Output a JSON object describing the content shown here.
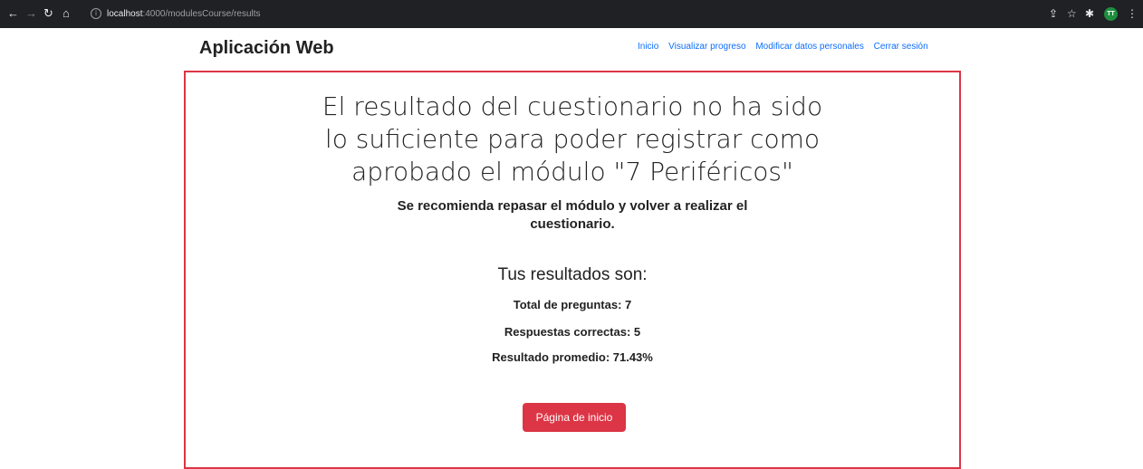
{
  "browser": {
    "url_host": "localhost",
    "url_rest": ":4000/modulesCourse/results",
    "avatar_initials": "TT"
  },
  "navbar": {
    "brand": "Aplicación Web",
    "links": [
      "Inicio",
      "Visualizar progreso",
      "Modificar datos personales",
      "Cerrar sesión"
    ]
  },
  "result": {
    "headline": "El resultado del cuestionario no ha sido lo suficiente para poder registrar como aprobado el módulo \"7 Periféricos\"",
    "recommendation": "Se recomienda repasar el módulo y volver a realizar el cuestionario.",
    "results_title": "Tus resultados son:",
    "total_questions": "Total de preguntas: 7",
    "correct_answers": "Respuestas correctas: 5",
    "average": "Resultado promedio: 71.43%",
    "home_button": "Página de inicio"
  },
  "colors": {
    "accent": "#dc3545",
    "link": "#0d6efd",
    "chrome": "#202124"
  }
}
